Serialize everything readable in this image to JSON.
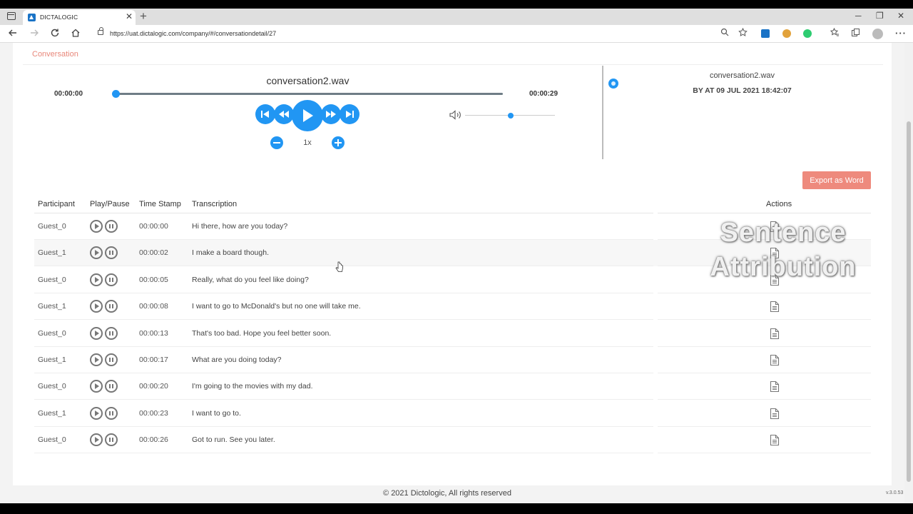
{
  "browser": {
    "tab_title": "DICTALOGIC",
    "url": "https://uat.dictalogic.com/company/#/conversationdetail/27",
    "minimize": "─",
    "restore": "❐",
    "close": "✕",
    "new_tab": "+",
    "tab_close": "✕"
  },
  "breadcrumb": "Conversation",
  "player": {
    "file_name": "conversation2.wav",
    "current_time": "00:00:00",
    "total_time": "00:00:29",
    "progress": 0,
    "speed": "1x",
    "volume": 0.5
  },
  "side_panel": {
    "file_name": "conversation2.wav",
    "meta": "BY AT 09 JUL 2021 18:42:07"
  },
  "export_label": "Export as Word",
  "table": {
    "headers": {
      "participant": "Participant",
      "play_pause": "Play/Pause",
      "timestamp": "Time Stamp",
      "transcription": "Transcription",
      "actions": "Actions"
    },
    "rows": [
      {
        "participant": "Guest_0",
        "timestamp": "00:00:00",
        "text": "Hi there, how are you today?"
      },
      {
        "participant": "Guest_1",
        "timestamp": "00:00:02",
        "text": "I make a board though."
      },
      {
        "participant": "Guest_0",
        "timestamp": "00:00:05",
        "text": "Really, what do you feel like doing?"
      },
      {
        "participant": "Guest_1",
        "timestamp": "00:00:08",
        "text": "I want to go to McDonald's but no one will take me."
      },
      {
        "participant": "Guest_0",
        "timestamp": "00:00:13",
        "text": "That's too bad. Hope you feel better soon."
      },
      {
        "participant": "Guest_1",
        "timestamp": "00:00:17",
        "text": "What are you doing today?"
      },
      {
        "participant": "Guest_0",
        "timestamp": "00:00:20",
        "text": "I'm going to the movies with my dad."
      },
      {
        "participant": "Guest_1",
        "timestamp": "00:00:23",
        "text": "I want to go to."
      },
      {
        "participant": "Guest_0",
        "timestamp": "00:00:26",
        "text": "Got to run. See you later."
      }
    ]
  },
  "overlay": {
    "line1": "Sentence",
    "line2": "Attribution"
  },
  "footer": "© 2021 Dictologic, All rights reserved",
  "version": "v.3.0.53",
  "colors": {
    "accent": "#2196f3",
    "export": "#ee8a7d",
    "breadcrumb": "#e8877a"
  }
}
